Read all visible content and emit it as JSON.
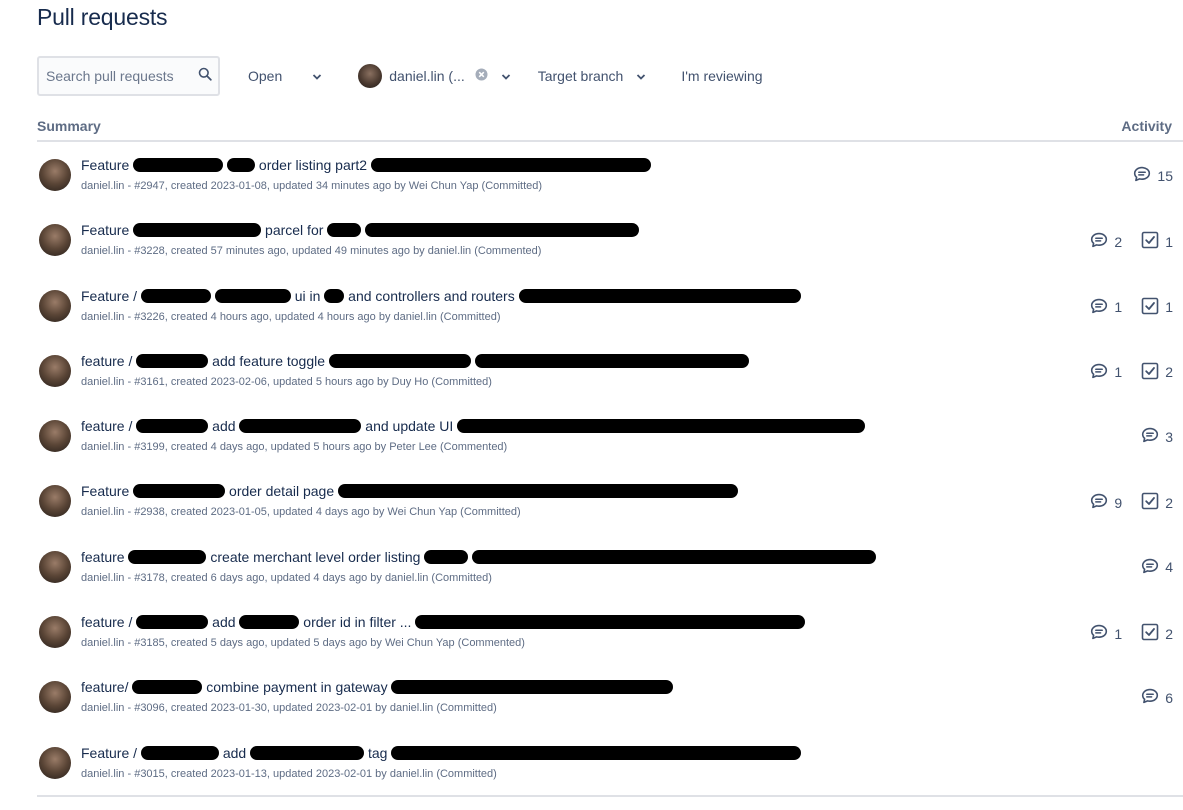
{
  "page": {
    "title": "Pull requests"
  },
  "filters": {
    "search_placeholder": "Search pull requests",
    "state_label": "Open",
    "author_label": "daniel.lin (...",
    "target_branch_label": "Target branch",
    "reviewing_label": "I'm reviewing"
  },
  "table": {
    "summary_header": "Summary",
    "activity_header": "Activity"
  },
  "pull_requests": [
    {
      "title_prefix": "Feature",
      "title_parts": [
        "order listing part2"
      ],
      "meta": "daniel.lin - #2947, created 2023-01-08, updated 34 minutes ago by Wei Chun Yap (Committed)",
      "comments": "15",
      "tasks": ""
    },
    {
      "title_prefix": "Feature",
      "title_parts": [
        "parcel for"
      ],
      "meta": "daniel.lin - #3228, created 57 minutes ago, updated 49 minutes ago by daniel.lin (Commented)",
      "comments": "2",
      "tasks": "1"
    },
    {
      "title_prefix": "Feature /",
      "title_parts": [
        "ui in",
        "and controllers and routers"
      ],
      "meta": "daniel.lin - #3226, created 4 hours ago, updated 4 hours ago by daniel.lin (Committed)",
      "comments": "1",
      "tasks": "1"
    },
    {
      "title_prefix": "feature /",
      "title_parts": [
        "add feature toggle"
      ],
      "meta": "daniel.lin - #3161, created 2023-02-06, updated 5 hours ago by Duy Ho (Committed)",
      "comments": "1",
      "tasks": "2"
    },
    {
      "title_prefix": "feature /",
      "title_parts": [
        "add",
        "and update UI"
      ],
      "meta": "daniel.lin - #3199, created 4 days ago, updated 5 hours ago by Peter Lee (Commented)",
      "comments": "3",
      "tasks": ""
    },
    {
      "title_prefix": "Feature",
      "title_parts": [
        "order detail page"
      ],
      "meta": "daniel.lin - #2938, created 2023-01-05, updated 4 days ago by Wei Chun Yap (Committed)",
      "comments": "9",
      "tasks": "2"
    },
    {
      "title_prefix": "feature",
      "title_parts": [
        "create merchant level order listing"
      ],
      "meta": "daniel.lin - #3178, created 6 days ago, updated 4 days ago by daniel.lin (Committed)",
      "comments": "4",
      "tasks": ""
    },
    {
      "title_prefix": "feature /",
      "title_parts": [
        "add",
        "order id in filter",
        "..."
      ],
      "meta": "daniel.lin - #3185, created 5 days ago, updated 5 days ago by Wei Chun Yap (Commented)",
      "comments": "1",
      "tasks": "2"
    },
    {
      "title_prefix": "feature/",
      "title_parts": [
        "combine payment in gateway"
      ],
      "meta": "daniel.lin - #3096, created 2023-01-30, updated 2023-02-01 by daniel.lin (Committed)",
      "comments": "6",
      "tasks": ""
    },
    {
      "title_prefix": "Feature /",
      "title_parts": [
        "add",
        "tag"
      ],
      "meta": "daniel.lin - #3015, created 2023-01-13, updated 2023-02-01 by daniel.lin (Committed)",
      "comments": "",
      "tasks": ""
    }
  ],
  "icons": {
    "search": "search-icon",
    "chevron": "chevron-down-icon",
    "clear": "clear-icon",
    "comment": "comment-icon",
    "task": "task-checkbox-icon"
  },
  "colors": {
    "text": "#172b4d",
    "muted": "#5e6c84",
    "border": "#dfe1e6"
  }
}
